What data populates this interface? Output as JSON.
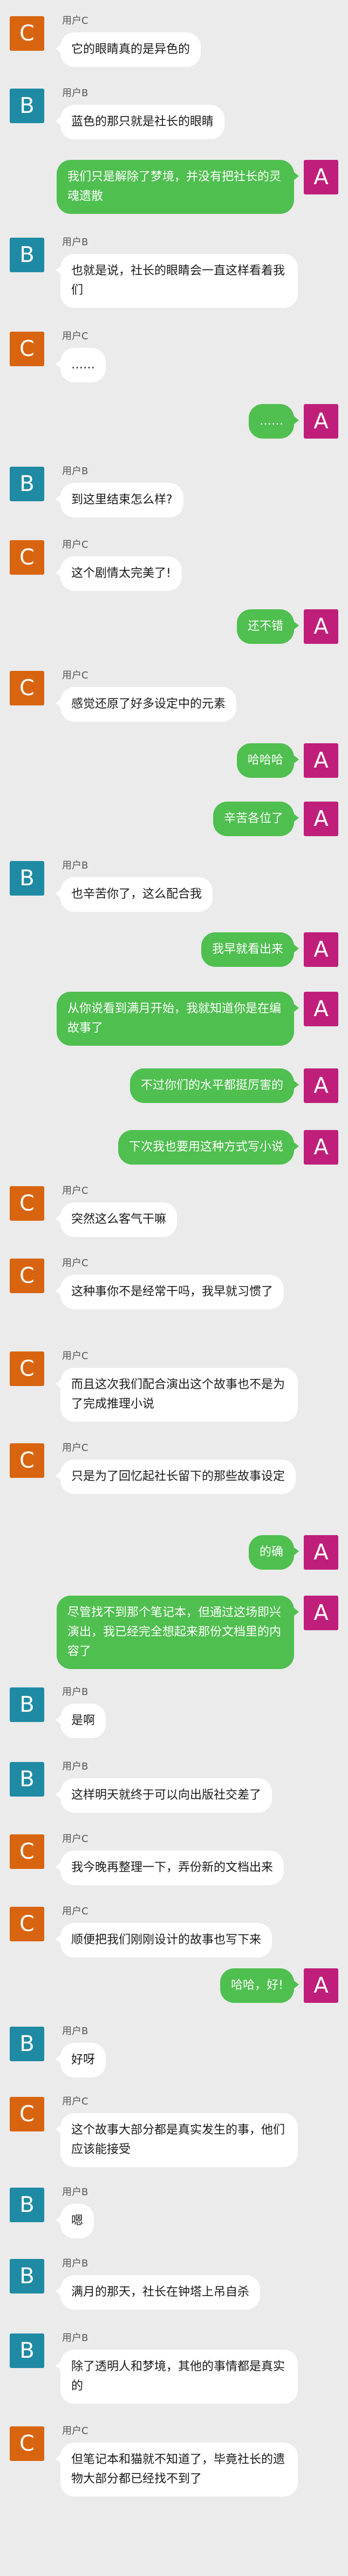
{
  "colors": {
    "background": "#ebebeb",
    "avatar_C": "#d9640f",
    "avatar_B": "#1f8aa3",
    "avatar_A": "#bf1f7a",
    "bubble_left": "#ffffff",
    "bubble_right": "#4fbf4f"
  },
  "messages": [
    {
      "side": "left",
      "avatar": "C",
      "name": "用户C",
      "text": "它的眼睛真的是异色的"
    },
    {
      "side": "left",
      "avatar": "B",
      "name": "用户B",
      "text": "蓝色的那只就是社长的眼睛"
    },
    {
      "side": "right",
      "avatar": "A",
      "name": "",
      "text": "我们只是解除了梦境，并没有把社长的灵魂遗散"
    },
    {
      "side": "left",
      "avatar": "B",
      "name": "用户B",
      "text": "也就是说，社长的眼睛会一直这样看着我们"
    },
    {
      "side": "left",
      "avatar": "C",
      "name": "用户C",
      "text": "……"
    },
    {
      "side": "right",
      "avatar": "A",
      "name": "",
      "text": "……"
    },
    {
      "side": "left",
      "avatar": "B",
      "name": "用户B",
      "text": "到这里结束怎么样?"
    },
    {
      "side": "left",
      "avatar": "C",
      "name": "用户C",
      "text": "这个剧情太完美了!"
    },
    {
      "side": "right",
      "avatar": "A",
      "name": "",
      "text": "还不错"
    },
    {
      "side": "left",
      "avatar": "C",
      "name": "用户C",
      "text": "感觉还原了好多设定中的元素"
    },
    {
      "side": "right",
      "avatar": "A",
      "name": "",
      "text": "哈哈哈"
    },
    {
      "side": "right",
      "avatar": "A",
      "name": "",
      "text": "辛苦各位了"
    },
    {
      "side": "left",
      "avatar": "B",
      "name": "用户B",
      "text": "也辛苦你了，这么配合我"
    },
    {
      "side": "right",
      "avatar": "A",
      "name": "",
      "text": "我早就看出来"
    },
    {
      "side": "right",
      "avatar": "A",
      "name": "",
      "text": "从你说看到满月开始，我就知道你是在编故事了"
    },
    {
      "side": "right",
      "avatar": "A",
      "name": "",
      "text": "不过你们的水平都挺厉害的"
    },
    {
      "side": "right",
      "avatar": "A",
      "name": "",
      "text": "下次我也要用这种方式写小说"
    },
    {
      "side": "left",
      "avatar": "C",
      "name": "用户C",
      "text": "突然这么客气干嘛"
    },
    {
      "side": "left",
      "avatar": "C",
      "name": "用户C",
      "text": "这种事你不是经常干吗，我早就习惯了"
    },
    {
      "side": "left",
      "avatar": "C",
      "name": "用户C",
      "text": "而且这次我们配合演出这个故事也不是为了完成推理小说"
    },
    {
      "side": "left",
      "avatar": "C",
      "name": "用户C",
      "text": "只是为了回忆起社长留下的那些故事设定"
    },
    {
      "side": "right",
      "avatar": "A",
      "name": "",
      "text": "的确"
    },
    {
      "side": "right",
      "avatar": "A",
      "name": "",
      "text": "尽管找不到那个笔记本，但通过这场即兴演出，我已经完全想起来那份文档里的内容了"
    },
    {
      "side": "left",
      "avatar": "B",
      "name": "用户B",
      "text": "是啊"
    },
    {
      "side": "left",
      "avatar": "B",
      "name": "用户B",
      "text": "这样明天就终于可以向出版社交差了"
    },
    {
      "side": "left",
      "avatar": "C",
      "name": "用户C",
      "text": "我今晚再整理一下，弄份新的文档出来"
    },
    {
      "side": "left",
      "avatar": "C",
      "name": "用户C",
      "text": "顺便把我们刚刚设计的故事也写下来"
    },
    {
      "side": "right",
      "avatar": "A",
      "name": "",
      "text": "哈哈，好!"
    },
    {
      "side": "left",
      "avatar": "B",
      "name": "用户B",
      "text": "好呀"
    },
    {
      "side": "left",
      "avatar": "C",
      "name": "用户C",
      "text": "这个故事大部分都是真实发生的事，他们应该能接受"
    },
    {
      "side": "left",
      "avatar": "B",
      "name": "用户B",
      "text": "嗯"
    },
    {
      "side": "left",
      "avatar": "B",
      "name": "用户B",
      "text": "满月的那天，社长在钟塔上吊自杀"
    },
    {
      "side": "left",
      "avatar": "B",
      "name": "用户B",
      "text": "除了透明人和梦境，其他的事情都是真实的"
    },
    {
      "side": "left",
      "avatar": "C",
      "name": "用户C",
      "text": "但笔记本和猫就不知道了，毕竟社长的遗物大部分都已经找不到了"
    }
  ]
}
